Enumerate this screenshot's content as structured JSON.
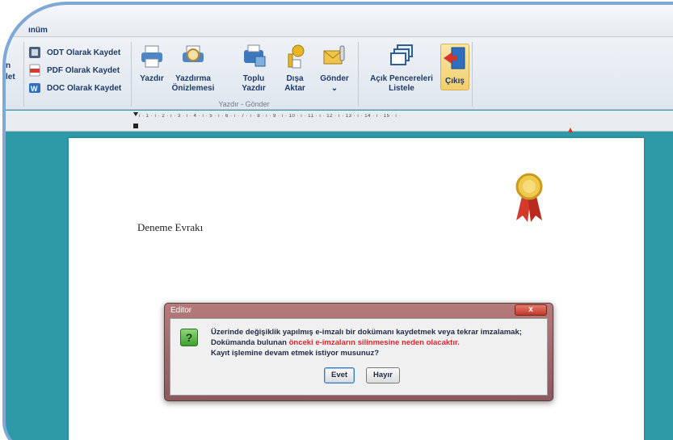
{
  "menu": {
    "partial_label": "ınüm"
  },
  "ribbon": {
    "left_partial": [
      "n",
      "let"
    ],
    "save_items": [
      {
        "label": "ODT Olarak Kaydet",
        "icon": "odt-file-icon",
        "color": "#4a5f7a"
      },
      {
        "label": "PDF Olarak Kaydet",
        "icon": "pdf-file-icon",
        "color": "#d23a32"
      },
      {
        "label": "DOC Olarak Kaydet",
        "icon": "doc-file-icon",
        "color": "#2f6fc1"
      }
    ],
    "print_group": {
      "caption": "Yazdır - Gönder",
      "buttons": [
        {
          "label": "Yazdır",
          "icon": "printer-icon"
        },
        {
          "label": "Yazdırma\nÖnizlemesi",
          "icon": "print-preview-icon"
        },
        {
          "label": "Toplu\nYazdır",
          "icon": "batch-print-icon"
        },
        {
          "label": "Dışa\nAktar",
          "icon": "export-key-icon"
        },
        {
          "label": "Gönder\n⌄",
          "icon": "send-mail-icon"
        }
      ]
    },
    "window_group": {
      "buttons": [
        {
          "label": "Açık Pencereleri\nListele",
          "icon": "windows-list-icon"
        },
        {
          "label": "Çıkış",
          "icon": "exit-door-icon"
        }
      ]
    }
  },
  "ruler": {
    "text": "· ı · 1 · ı · 2 · ı · 3 · ı · 4 · ı · 5 · ı · 6 · ı · 7 · ı · 8 · ı · 9 · ı · 10 · ı · 11 · ı · 12 · ı · 13 · ı · 14 · ı · 15 · ı ·"
  },
  "document": {
    "text": "Deneme Evrakı",
    "badge_icon": "award-ribbon-icon"
  },
  "dialog": {
    "title": "Editor",
    "close": "x",
    "line1": "Üzerinde değişiklik yapılmış e-imzalı bir dokümanı kaydetmek veya tekrar imzalamak;",
    "line2_prefix": "Dokümanda bulunan ",
    "line2_warn": "önceki e-imzaların silinmesine neden olacaktır.",
    "line3": "Kayıt işlemine devam etmek istiyor musunuz?",
    "yes": "Evet",
    "no": "Hayır",
    "icon": "question-icon"
  },
  "colors": {
    "background": "#2e9aa7",
    "warning": "#e0262b",
    "dialog_frame": "#8a5a5f"
  }
}
